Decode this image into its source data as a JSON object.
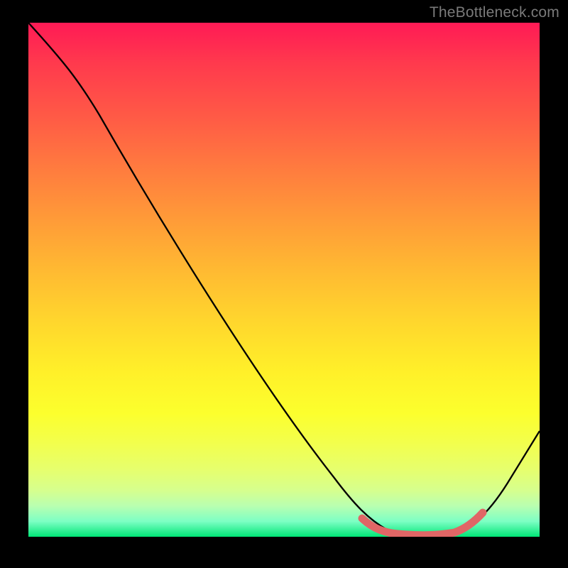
{
  "watermark": "TheBottleneck.com",
  "chart_data": {
    "type": "line",
    "title": "",
    "xlabel": "",
    "ylabel": "",
    "xlim": [
      0,
      100
    ],
    "ylim": [
      0,
      100
    ],
    "series": [
      {
        "name": "bottleneck-curve",
        "x": [
          0,
          6,
          12,
          20,
          30,
          40,
          50,
          60,
          66,
          70,
          74,
          78,
          82,
          84,
          88,
          92,
          96,
          100
        ],
        "values": [
          100,
          94,
          87,
          77,
          63,
          49,
          35,
          21,
          12,
          6,
          2,
          0.5,
          0.5,
          0.5,
          2,
          6,
          12,
          20
        ]
      },
      {
        "name": "optimal-band",
        "x": [
          66,
          70,
          74,
          78,
          82,
          84,
          88
        ],
        "values": [
          3.2,
          1.8,
          1.2,
          1.0,
          1.0,
          1.2,
          2.4
        ]
      }
    ],
    "colors": {
      "curve": "#000000",
      "band": "#e06666",
      "gradient_top": "#ff1a55",
      "gradient_bottom": "#00e676"
    },
    "annotations": []
  }
}
